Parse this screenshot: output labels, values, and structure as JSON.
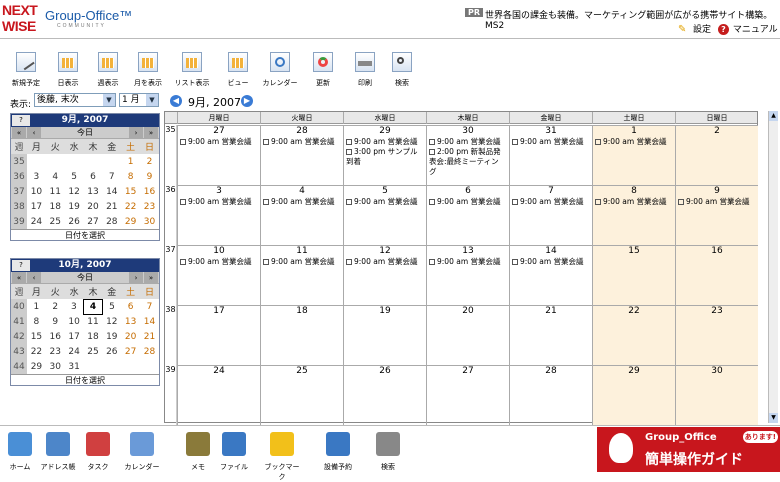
{
  "header": {
    "logo_top": "NEXT",
    "logo_bottom": "WISE",
    "brand": "Group-Office™",
    "brand_sub": "COMMUNITY",
    "pr_badge": "PR",
    "ad_text": "世界各国の課金も装備。マーケティング範囲が広がる携帯サイト構築。MS2",
    "settings": "設定",
    "manual": "マニュアル"
  },
  "toolbar": [
    {
      "label": "新規予定",
      "icon": "new-event-icon"
    },
    {
      "label": "日表示",
      "icon": "day-view-icon"
    },
    {
      "label": "週表示",
      "icon": "week-view-icon"
    },
    {
      "label": "月を表示",
      "icon": "month-view-icon"
    },
    {
      "label": "リスト表示",
      "icon": "list-view-icon"
    },
    {
      "label": "ビュー",
      "icon": "view-icon"
    },
    {
      "label": "カレンダー",
      "icon": "calendar-icon"
    },
    {
      "label": "更新",
      "icon": "refresh-icon"
    },
    {
      "label": "印刷",
      "icon": "print-icon"
    },
    {
      "label": "検索",
      "icon": "search-icon"
    }
  ],
  "display": {
    "label": "表示:",
    "user_value": "後藤, 末次",
    "month_value": "1 月",
    "title": "9月, 2007"
  },
  "mini1": {
    "help": "?",
    "title": "9月, 2007",
    "today": "今日",
    "weekday_header": [
      "週",
      "月",
      "火",
      "水",
      "木",
      "金",
      "土",
      "日"
    ],
    "rows": [
      [
        "35",
        "",
        "",
        "",
        "",
        "",
        "1",
        "2"
      ],
      [
        "36",
        "3",
        "4",
        "5",
        "6",
        "7",
        "8",
        "9"
      ],
      [
        "37",
        "10",
        "11",
        "12",
        "13",
        "14",
        "15",
        "16"
      ],
      [
        "38",
        "17",
        "18",
        "19",
        "20",
        "21",
        "22",
        "23"
      ],
      [
        "39",
        "24",
        "25",
        "26",
        "27",
        "28",
        "29",
        "30"
      ]
    ],
    "pick": "日付を選択"
  },
  "mini2": {
    "help": "?",
    "title": "10月, 2007",
    "today": "今日",
    "weekday_header": [
      "週",
      "月",
      "火",
      "水",
      "木",
      "金",
      "土",
      "日"
    ],
    "rows": [
      [
        "40",
        "1",
        "2",
        "3",
        "4",
        "5",
        "6",
        "7"
      ],
      [
        "41",
        "8",
        "9",
        "10",
        "11",
        "12",
        "13",
        "14"
      ],
      [
        "42",
        "15",
        "16",
        "17",
        "18",
        "19",
        "20",
        "21"
      ],
      [
        "43",
        "22",
        "23",
        "24",
        "25",
        "26",
        "27",
        "28"
      ],
      [
        "44",
        "29",
        "30",
        "31",
        "",
        "",
        "",
        ""
      ]
    ],
    "pick": "日付を選択"
  },
  "grid": {
    "headers": [
      "月曜日",
      "火曜日",
      "水曜日",
      "木曜日",
      "金曜日",
      "土曜日",
      "日曜日"
    ],
    "weeks": [
      {
        "num": "35",
        "days": [
          {
            "d": "27",
            "ev": [
              "9:00 am 営業会議"
            ]
          },
          {
            "d": "28",
            "ev": [
              "9:00 am 営業会議"
            ]
          },
          {
            "d": "29",
            "ev": [
              "9:00 am 営業会議",
              "3:00 pm サンプル到着"
            ]
          },
          {
            "d": "30",
            "ev": [
              "9:00 am 営業会議",
              "2:00 pm 新製品発表会:最終ミーティング"
            ]
          },
          {
            "d": "31",
            "ev": [
              "9:00 am 営業会議"
            ]
          },
          {
            "d": "1",
            "ev": [
              "9:00 am 営業会議"
            ]
          },
          {
            "d": "2",
            "ev": []
          }
        ]
      },
      {
        "num": "36",
        "days": [
          {
            "d": "3",
            "ev": [
              "9:00 am 営業会議"
            ]
          },
          {
            "d": "4",
            "ev": [
              "9:00 am 営業会議"
            ]
          },
          {
            "d": "5",
            "ev": [
              "9:00 am 営業会議"
            ]
          },
          {
            "d": "6",
            "ev": [
              "9:00 am 営業会議"
            ]
          },
          {
            "d": "7",
            "ev": [
              "9:00 am 営業会議"
            ]
          },
          {
            "d": "8",
            "ev": [
              "9:00 am 営業会議"
            ]
          },
          {
            "d": "9",
            "ev": [
              "9:00 am 営業会議"
            ]
          }
        ]
      },
      {
        "num": "37",
        "days": [
          {
            "d": "10",
            "ev": [
              "9:00 am 営業会議"
            ]
          },
          {
            "d": "11",
            "ev": [
              "9:00 am 営業会議"
            ]
          },
          {
            "d": "12",
            "ev": [
              "9:00 am 営業会議"
            ]
          },
          {
            "d": "13",
            "ev": [
              "9:00 am 営業会議"
            ]
          },
          {
            "d": "14",
            "ev": [
              "9:00 am 営業会議"
            ]
          },
          {
            "d": "15",
            "ev": []
          },
          {
            "d": "16",
            "ev": []
          }
        ]
      },
      {
        "num": "38",
        "days": [
          {
            "d": "17",
            "ev": []
          },
          {
            "d": "18",
            "ev": []
          },
          {
            "d": "19",
            "ev": []
          },
          {
            "d": "20",
            "ev": []
          },
          {
            "d": "21",
            "ev": []
          },
          {
            "d": "22",
            "ev": []
          },
          {
            "d": "23",
            "ev": []
          }
        ]
      },
      {
        "num": "39",
        "days": [
          {
            "d": "24",
            "ev": []
          },
          {
            "d": "25",
            "ev": []
          },
          {
            "d": "26",
            "ev": []
          },
          {
            "d": "27",
            "ev": []
          },
          {
            "d": "28",
            "ev": []
          },
          {
            "d": "29",
            "ev": []
          },
          {
            "d": "30",
            "ev": []
          }
        ]
      }
    ]
  },
  "bottom": [
    {
      "label": "ホーム",
      "icon": "home-icon",
      "color": "#4a8fd6"
    },
    {
      "label": "アドレス帳",
      "icon": "address-book-icon",
      "color": "#4d86c9"
    },
    {
      "label": "タスク",
      "icon": "task-icon",
      "color": "#d04040"
    },
    {
      "label": "カレンダー",
      "icon": "calendar-icon",
      "color": "#6a9ad8"
    },
    {
      "label": "メモ",
      "icon": "memo-icon",
      "color": "#8a7a3a"
    },
    {
      "label": "ファイル",
      "icon": "file-icon",
      "color": "#3a78c3"
    },
    {
      "label": "ブックマーク",
      "icon": "bookmark-icon",
      "color": "#f2c01a"
    },
    {
      "label": "設備予約",
      "icon": "reservation-icon",
      "color": "#3a78c3"
    },
    {
      "label": "検索",
      "icon": "search-icon",
      "color": "#888888"
    }
  ],
  "guide": {
    "title": "Group_Office",
    "badge": "あります!",
    "main": "簡単操作ガイド"
  }
}
